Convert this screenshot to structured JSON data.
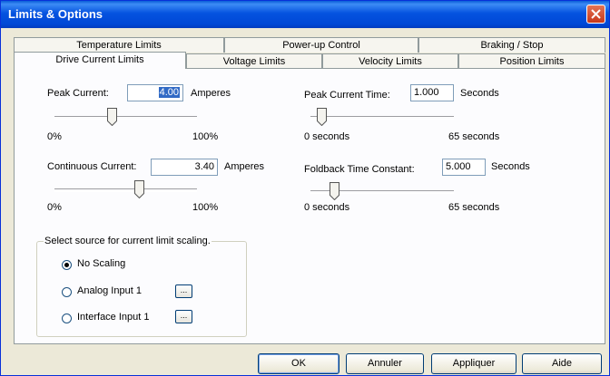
{
  "window": {
    "title": "Limits & Options"
  },
  "tabs": {
    "row_back": [
      {
        "label": "Temperature Limits"
      },
      {
        "label": "Power-up Control"
      },
      {
        "label": "Braking / Stop"
      }
    ],
    "row_front": [
      {
        "label": "Drive Current Limits",
        "active": true
      },
      {
        "label": "Voltage Limits"
      },
      {
        "label": "Velocity Limits"
      },
      {
        "label": "Position Limits"
      }
    ]
  },
  "peak_current": {
    "label": "Peak Current:",
    "value": "4.00",
    "unit": "Amperes",
    "min_label": "0%",
    "max_label": "100%",
    "slider_level": 0.4
  },
  "continuous_current": {
    "label": "Continuous Current:",
    "value": "3.40",
    "unit": "Amperes",
    "min_label": "0%",
    "max_label": "100%",
    "slider_level": 0.6
  },
  "peak_current_time": {
    "label": "Peak Current Time:",
    "value": "1.000",
    "unit": "Seconds",
    "min_label": "0 seconds",
    "max_label": "65 seconds",
    "slider_level": 0.05
  },
  "foldback_time": {
    "label": "Foldback Time Constant:",
    "value": "5.000",
    "unit": "Seconds",
    "min_label": "0 seconds",
    "max_label": "65 seconds",
    "slider_level": 0.14
  },
  "scaling": {
    "title": "Select source for current limit scaling.",
    "options": [
      {
        "label": "No Scaling",
        "checked": true
      },
      {
        "label": "Analog Input 1",
        "checked": false,
        "button": "..."
      },
      {
        "label": "Interface Input 1",
        "checked": false,
        "button": "..."
      }
    ]
  },
  "buttons": {
    "ok": "OK",
    "cancel": "Annuler",
    "apply": "Appliquer",
    "help": "Aide"
  },
  "colors": {
    "title_bar": "#0054e3",
    "selection": "#316ac5",
    "close": "#c8371a"
  }
}
